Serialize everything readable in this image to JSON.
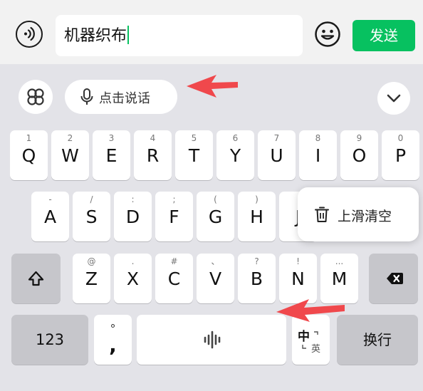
{
  "input_bar": {
    "voice_icon": "voice-wave-icon",
    "message_text": "机器织布",
    "emoji_icon": "smiley-face-icon",
    "send_label": "发送"
  },
  "keyboard_toolbar": {
    "menu_icon": "four-clover-grid-icon",
    "voice_input_label": "点击说话",
    "mic_icon": "microphone-icon",
    "collapse_icon": "chevron-down-icon"
  },
  "rows": {
    "row1": [
      {
        "main": "Q",
        "sub": "1"
      },
      {
        "main": "W",
        "sub": "2"
      },
      {
        "main": "E",
        "sub": "3"
      },
      {
        "main": "R",
        "sub": "4"
      },
      {
        "main": "T",
        "sub": "5"
      },
      {
        "main": "Y",
        "sub": "6"
      },
      {
        "main": "U",
        "sub": "7"
      },
      {
        "main": "I",
        "sub": "8"
      },
      {
        "main": "O",
        "sub": "9"
      },
      {
        "main": "P",
        "sub": "0"
      }
    ],
    "row2": [
      {
        "main": "A",
        "sub": "-"
      },
      {
        "main": "S",
        "sub": "/"
      },
      {
        "main": "D",
        "sub": ":"
      },
      {
        "main": "F",
        "sub": ";"
      },
      {
        "main": "G",
        "sub": "("
      },
      {
        "main": "H",
        "sub": ")"
      },
      {
        "main": "J",
        "sub": ""
      }
    ],
    "row3": [
      {
        "main": "Z",
        "sub": "@"
      },
      {
        "main": "X",
        "sub": "."
      },
      {
        "main": "C",
        "sub": "#"
      },
      {
        "main": "V",
        "sub": "、"
      },
      {
        "main": "B",
        "sub": "?"
      },
      {
        "main": "N",
        "sub": "!"
      },
      {
        "main": "M",
        "sub": "..."
      }
    ]
  },
  "special_keys": {
    "shift_icon": "shift-arrow-icon",
    "backspace_icon": "backspace-icon",
    "numbers_label": "123",
    "punct_top": "°",
    "punct_bottom": ",",
    "space_icon": "voice-bars-icon",
    "lang_main": "中",
    "lang_alt": "英",
    "enter_label": "换行"
  },
  "swipe_popup": {
    "icon": "trash-icon",
    "label": "上滑清空"
  },
  "annotations": {
    "arrow_color": "#f0484c"
  },
  "colors": {
    "accent_green": "#07c160"
  }
}
